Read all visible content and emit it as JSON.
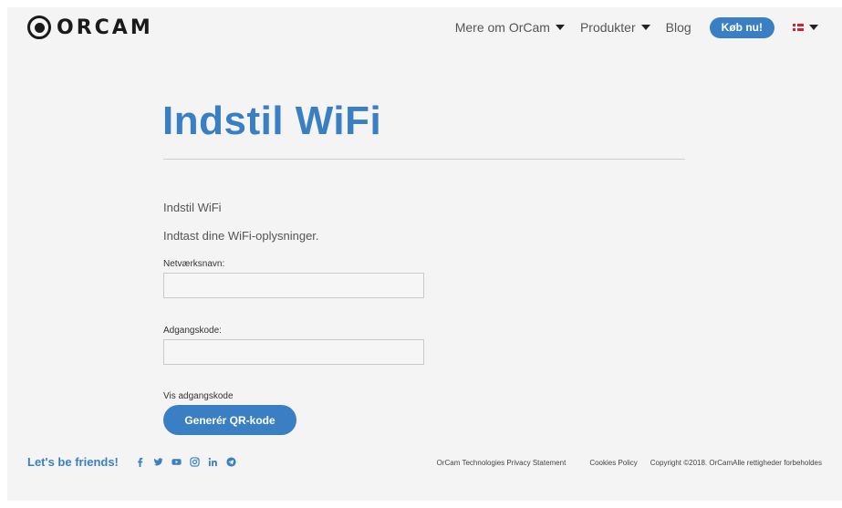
{
  "header": {
    "logo_text": "ORCAM",
    "nav": [
      {
        "label": "Mere om OrCam",
        "has_dropdown": true
      },
      {
        "label": "Produkter",
        "has_dropdown": true
      },
      {
        "label": "Blog",
        "has_dropdown": false
      }
    ],
    "buy_label": "Køb nu!",
    "language_flag": "danish-flag-icon"
  },
  "main": {
    "title": "Indstil WiFi",
    "subheading": "Indstil WiFi",
    "intro": "Indtast dine WiFi-oplysninger.",
    "network": {
      "label": "Netværksnavn:",
      "value": "",
      "placeholder": ""
    },
    "password": {
      "label": "Adgangskode:",
      "value": "",
      "placeholder": ""
    },
    "show_password_label": "Vis adgangskode",
    "generate_button_label": "Generér QR-kode"
  },
  "footer": {
    "friends_label": "Let's be friends!",
    "socials": [
      "facebook-icon",
      "twitter-icon",
      "youtube-icon",
      "instagram-icon",
      "linkedin-icon",
      "telegram-icon"
    ],
    "links": [
      "OrCam Technologies Privacy Statement",
      "Cookies Policy"
    ],
    "copyright": "Copyright ©2018. OrCamAlle rettigheder forbeholdes"
  },
  "colors": {
    "accent": "#3a7fc4",
    "background": "#f4f4f4",
    "flag_red": "#d8202f"
  }
}
